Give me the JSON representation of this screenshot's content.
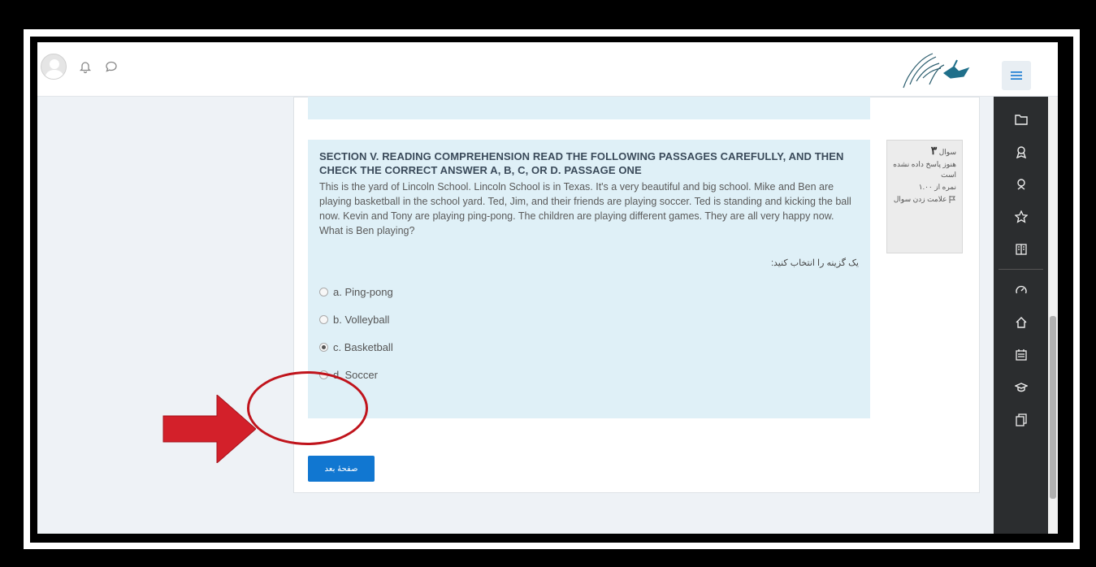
{
  "navbar": {
    "user_icons": [
      "avatar",
      "bell-icon",
      "chat-icon"
    ],
    "menu_icon": "hamburger-icon"
  },
  "question": {
    "title": "SECTION V. READING COMPREHENSION READ THE FOLLOWING PASSAGES CAREFULLY, AND THEN CHECK THE CORRECT ANSWER A, B, C, OR D. PASSAGE ONE",
    "text": "This is the yard of Lincoln School. Lincoln School is in Texas. It's a very beautiful and big school. Mike and Ben are playing basketball in the school yard. Ted, Jim, and their friends are playing soccer. Ted is standing and kicking the ball now. Kevin and Tony are playing ping-pong. The children are playing different games. They are all very happy now. What is Ben playing?",
    "prompt": "یک گزینه را انتخاب کنید:",
    "options": [
      {
        "label": "a. Ping-pong",
        "checked": false
      },
      {
        "label": "b. Volleyball",
        "checked": false
      },
      {
        "label": "c. Basketball",
        "checked": true
      },
      {
        "label": "d. Soccer",
        "checked": false
      }
    ]
  },
  "info": {
    "question_label": "سوال",
    "question_number": "۳",
    "status": "هنوز پاسخ داده نشده است",
    "mark": "نمره از ۱.۰۰",
    "flag": "علامت زدن سوال"
  },
  "next_button": "صفحهٔ بعد",
  "sidebar_icons": [
    "folder-icon",
    "badge-icon",
    "award-icon",
    "star-icon",
    "book-icon",
    "dashboard-icon",
    "home-icon",
    "calendar-icon",
    "graduation-icon",
    "files-icon"
  ],
  "colors": {
    "accent": "#1177d1",
    "question_bg": "#dff0f7",
    "sidebar_bg": "#2b2d2f",
    "annotation": "#c0141c"
  }
}
